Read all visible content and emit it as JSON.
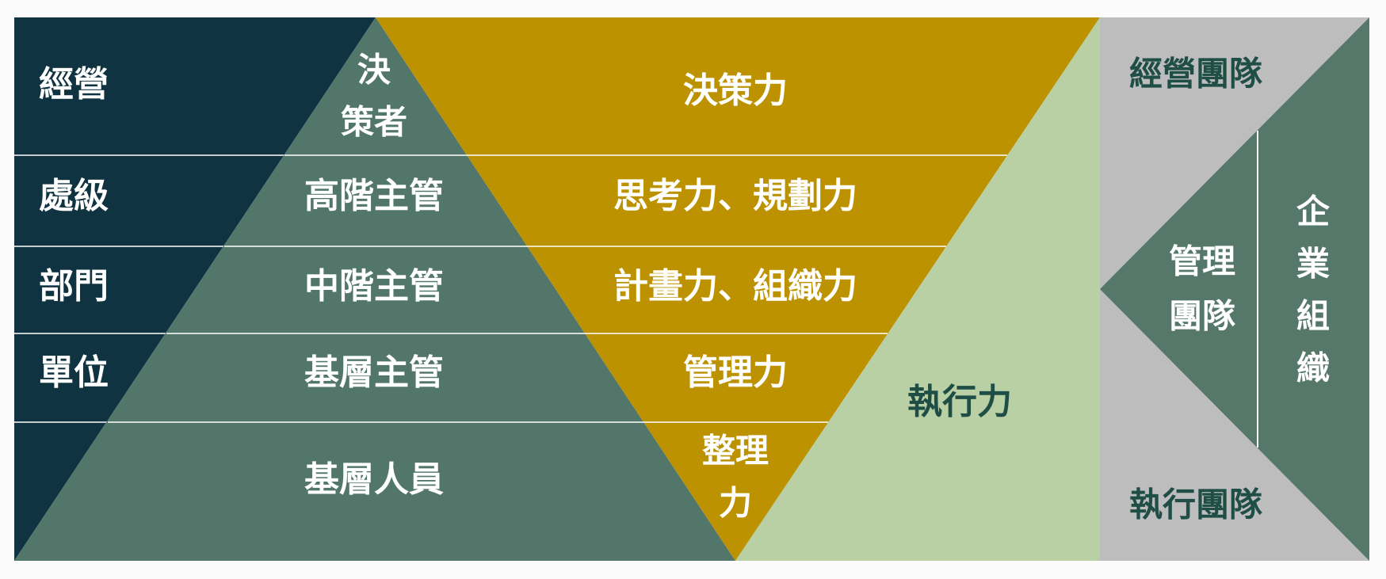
{
  "left_levels": {
    "l1": "經營",
    "l2": "處級",
    "l3": "部門",
    "l4": "單位"
  },
  "pyramid": {
    "t1a": "決",
    "t1b": "策者",
    "t2": "高階主管",
    "t3": "中階主管",
    "t4": "基層主管",
    "t5": "基層人員"
  },
  "abilities": {
    "a1": "決策力",
    "a2": "思考力、規劃力",
    "a3": "計畫力、組織力",
    "a4": "管理力",
    "a5a": "整理",
    "a5b": "力"
  },
  "execution": {
    "label": "執行力"
  },
  "teams": {
    "management_team": "經營團隊",
    "middle_team_a": "管理",
    "middle_team_b": "團隊",
    "execution_team": "執行團隊"
  },
  "organization": {
    "c1": "企",
    "c2": "業",
    "c3": "組",
    "c4": "織"
  },
  "colors": {
    "navy": "#103341",
    "teal": "#52766a",
    "gold": "#bd9200",
    "light_green": "#b8d0a3",
    "gray": "#bdbdbd",
    "right_green": "#55786b",
    "text_dark": "#1f4e46"
  }
}
